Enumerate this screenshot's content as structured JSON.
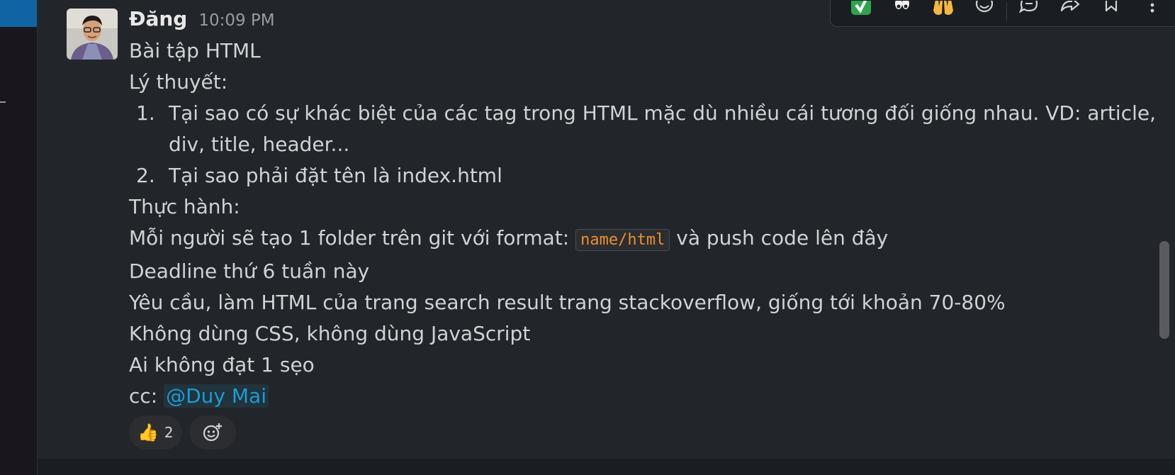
{
  "message": {
    "author": "Đăng",
    "time": "10:09 PM",
    "lines": {
      "title": "Bài tập HTML",
      "theory": "Lý thuyết:",
      "practice": "Thực hành:",
      "deadline": "Deadline thứ 6 tuần này",
      "requirement": "Yêu cầu, làm HTML của trang search result trang stackoverflow, giống tới khoản 70-80%",
      "no_css": "Không dùng CSS, không dùng JavaScript",
      "penalty": "Ai không đạt 1 sẹo"
    },
    "list": [
      {
        "num": "1.",
        "text": "Tại sao có sự khác biệt của các tag trong HTML mặc dù nhiều cái tương đối giống nhau. VD: article, div, title, header..."
      },
      {
        "num": "2.",
        "text": "Tại sao phải đặt tên là index.html"
      }
    ],
    "folder_line": {
      "before": "Mỗi người sẽ tạo 1 folder trên git với format: ",
      "code": "name/html",
      "after": " và push code lên đây"
    },
    "cc": {
      "prefix": "cc: ",
      "mention": "@Duy Mai"
    }
  },
  "reactions": [
    {
      "icon": "thumbs-up-icon",
      "emoji": "👍",
      "count": "2"
    }
  ],
  "toolbar": {
    "icons": [
      "check-mark-icon",
      "eyes-icon",
      "raised-hands-icon",
      "add-reaction-icon",
      "reply-thread-icon",
      "share-icon",
      "bookmark-icon",
      "more-actions-icon"
    ]
  },
  "colors": {
    "background": "#222529",
    "mention": "#1d9bd1",
    "code": "#e8912d",
    "sidebar_active": "#1164a3"
  }
}
